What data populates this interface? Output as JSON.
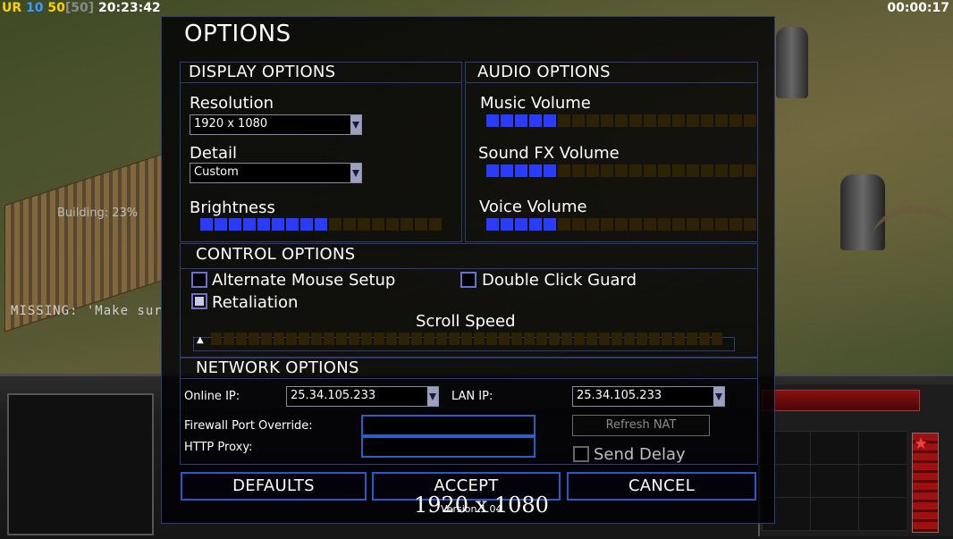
{
  "hud": {
    "ur": "UR",
    "num1": "10",
    "num2": "50",
    "num3": "[50]",
    "clock": "20:23:42",
    "timer": "00:00:17",
    "building": "Building: 23%",
    "missing": "MISSING: 'Make sur"
  },
  "dialog": {
    "title": "OPTIONS",
    "display": {
      "title": "DISPLAY OPTIONS",
      "resolution_label": "Resolution",
      "resolution_value": "1920 x 1080",
      "detail_label": "Detail",
      "detail_value": "Custom",
      "brightness_label": "Brightness",
      "brightness_level": 0.5
    },
    "audio": {
      "title": "AUDIO OPTIONS",
      "music_label": "Music Volume",
      "music_level": 0.26,
      "sfx_label": "Sound FX Volume",
      "sfx_level": 0.26,
      "voice_label": "Voice Volume",
      "voice_level": 0.26
    },
    "control": {
      "title": "CONTROL OPTIONS",
      "alt_mouse_label": "Alternate Mouse Setup",
      "alt_mouse_checked": false,
      "double_click_label": "Double Click Guard",
      "double_click_checked": false,
      "retaliation_label": "Retaliation",
      "retaliation_checked": true,
      "scroll_label": "Scroll Speed",
      "scroll_level": 0
    },
    "network": {
      "title": "NETWORK OPTIONS",
      "online_ip_label": "Online IP:",
      "online_ip_value": "25.34.105.233",
      "lan_ip_label": "LAN IP:",
      "lan_ip_value": "25.34.105.233",
      "firewall_label": "Firewall Port Override:",
      "firewall_value": "",
      "http_proxy_label": "HTTP Proxy:",
      "http_proxy_value": "",
      "refresh_nat_label": "Refresh NAT",
      "send_delay_label": "Send Delay",
      "send_delay_checked": false
    },
    "buttons": {
      "defaults": "DEFAULTS",
      "accept": "ACCEPT",
      "cancel": "CANCEL"
    },
    "version": "Version 1.04",
    "resolution_overlay": "1920 x 1080"
  },
  "colors": {
    "bar_on": "#2a3cff",
    "bar_off": "#2e2206",
    "border": "#2d3c78",
    "button_border": "#2d58c8"
  }
}
